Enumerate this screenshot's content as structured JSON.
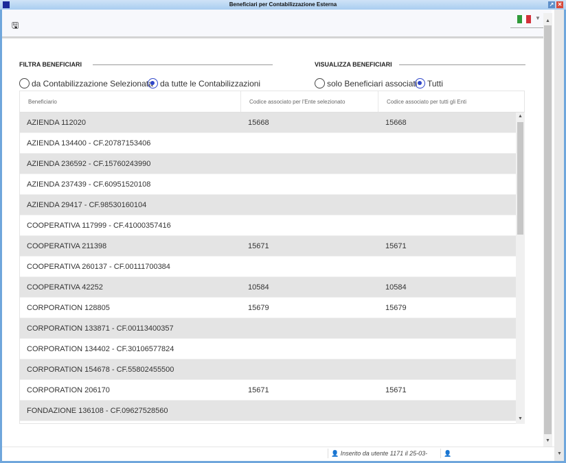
{
  "window": {
    "title": "Beneficiari per Contabilizzazione Esterna"
  },
  "toolbar": {
    "save_icon": "floppy-disk-icon",
    "language_icon": "italy-flag-icon"
  },
  "filter": {
    "title": "FILTRA BENEFICIARI",
    "options": [
      {
        "label": "da Contabilizzazione Selezionata",
        "selected": false
      },
      {
        "label": "da tutte le Contabilizzazioni",
        "selected": true
      }
    ]
  },
  "view": {
    "title": "VISUALIZZA BENEFICIARI",
    "options": [
      {
        "label": "solo Beneficiari associati",
        "selected": false
      },
      {
        "label": "Tutti",
        "selected": true
      }
    ]
  },
  "table": {
    "columns": [
      "Beneficiario",
      "Codice associato per l'Ente selezionato",
      "Codice associato per tutti gli Enti"
    ],
    "rows": [
      [
        "AZIENDA 112020",
        "15668",
        "15668"
      ],
      [
        "AZIENDA 134400 - CF.20787153406",
        "",
        ""
      ],
      [
        "AZIENDA 236592 - CF.15760243990",
        "",
        ""
      ],
      [
        "AZIENDA 237439 - CF.60951520108",
        "",
        ""
      ],
      [
        "AZIENDA 29417 - CF.98530160104",
        "",
        ""
      ],
      [
        "COOPERATIVA 117999 - CF.41000357416",
        "",
        ""
      ],
      [
        "COOPERATIVA 211398",
        "15671",
        "15671"
      ],
      [
        "COOPERATIVA 260137 - CF.00111700384",
        "",
        ""
      ],
      [
        "COOPERATIVA 42252",
        "10584",
        "10584"
      ],
      [
        "CORPORATION 128805",
        "15679",
        "15679"
      ],
      [
        "CORPORATION 133871 - CF.00113400357",
        "",
        ""
      ],
      [
        "CORPORATION 134402 - CF.30106577824",
        "",
        ""
      ],
      [
        "CORPORATION 154678 - CF.55802455500",
        "",
        ""
      ],
      [
        "CORPORATION 206170",
        "15671",
        "15671"
      ],
      [
        "FONDAZIONE 136108 - CF.09627528560",
        "",
        ""
      ]
    ]
  },
  "footer": {
    "inserted": "Inserito da utente 1171 il 25-03-",
    "user_icon": "user-icon"
  },
  "colors": {
    "accent": "#2f46c9",
    "row_alt": "#e4e4e4"
  }
}
